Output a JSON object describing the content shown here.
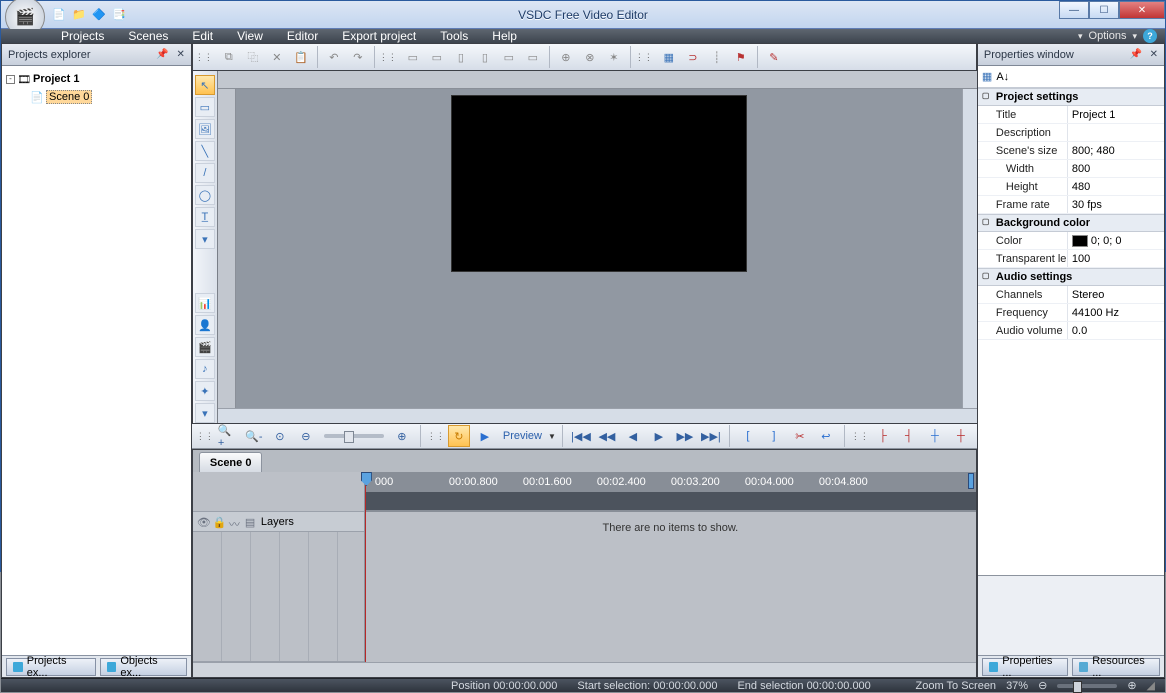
{
  "app_title": "VSDC Free Video Editor",
  "menubar": [
    "Projects",
    "Scenes",
    "Edit",
    "View",
    "Editor",
    "Export project",
    "Tools",
    "Help"
  ],
  "options_label": "Options",
  "explorer": {
    "title": "Projects explorer",
    "project": "Project 1",
    "scene": "Scene 0",
    "tabs": [
      "Projects ex...",
      "Objects ex..."
    ]
  },
  "properties": {
    "title": "Properties window",
    "tabs": [
      "Properties ...",
      "Resources ..."
    ],
    "sections": {
      "project_settings": "Project settings",
      "background_color": "Background color",
      "audio_settings": "Audio settings"
    },
    "rows": {
      "title": {
        "k": "Title",
        "v": "Project 1"
      },
      "description": {
        "k": "Description",
        "v": ""
      },
      "scene_size": {
        "k": "Scene's size",
        "v": "800; 480"
      },
      "width": {
        "k": "Width",
        "v": "800"
      },
      "height": {
        "k": "Height",
        "v": "480"
      },
      "frame_rate": {
        "k": "Frame rate",
        "v": "30 fps"
      },
      "color": {
        "k": "Color",
        "v": "0; 0; 0"
      },
      "transparent": {
        "k": "Transparent le",
        "v": "100"
      },
      "channels": {
        "k": "Channels",
        "v": "Stereo"
      },
      "frequency": {
        "k": "Frequency",
        "v": "44100 Hz"
      },
      "audio_volume": {
        "k": "Audio volume",
        "v": "0.0"
      }
    }
  },
  "timeline": {
    "scene_tab": "Scene 0",
    "layers_label": "Layers",
    "empty_msg": "There are no items to show.",
    "ticks": [
      "000",
      "00:00.800",
      "00:01.600",
      "00:02.400",
      "00:03.200",
      "00:04.000",
      "00:04.800"
    ],
    "preview_label": "Preview"
  },
  "status": {
    "position": "Position   00:00:00.000",
    "start_sel": "Start selection:   00:00:00.000",
    "end_sel": "End selection   00:00:00.000",
    "zoom_mode": "Zoom To Screen",
    "zoom_pct": "37%"
  }
}
